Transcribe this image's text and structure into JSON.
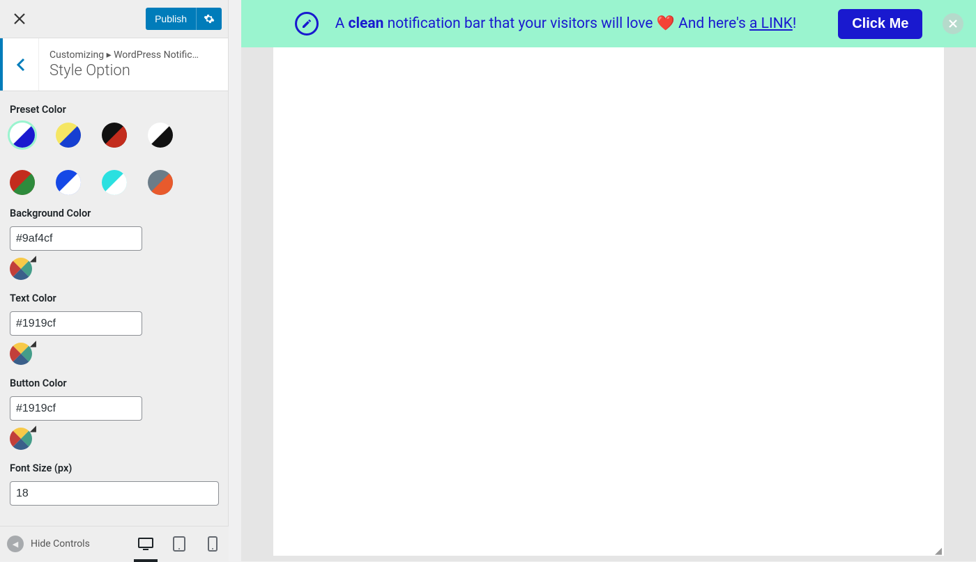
{
  "header": {
    "publish_label": "Publish"
  },
  "panel": {
    "breadcrumb": "Customizing ▸ WordPress Notific…",
    "title": "Style Option"
  },
  "preset_color": {
    "label": "Preset Color",
    "swatches": [
      {
        "a": "#ffffff",
        "b": "#1919cf",
        "selected": true
      },
      {
        "a": "#f5e663",
        "b": "#163fd1",
        "selected": false
      },
      {
        "a": "#111111",
        "b": "#c32c1d",
        "selected": false
      },
      {
        "a": "#ffffff",
        "b": "#111111",
        "selected": false
      },
      {
        "a": "#c32c1d",
        "b": "#2e8b3c",
        "selected": false
      },
      {
        "a": "#1548e6",
        "b": "#ffffff",
        "selected": false
      },
      {
        "a": "#2be0e0",
        "b": "#ffffff",
        "selected": false
      },
      {
        "a": "#6b7c88",
        "b": "#e85a2c",
        "selected": false
      }
    ]
  },
  "background_color": {
    "label": "Background Color",
    "value": "#9af4cf"
  },
  "text_color": {
    "label": "Text Color",
    "value": "#1919cf"
  },
  "button_color": {
    "label": "Button Color",
    "value": "#1919cf"
  },
  "font_size": {
    "label": "Font Size (px)",
    "value": "18"
  },
  "footer": {
    "hide_controls": "Hide Controls"
  },
  "notif": {
    "bg": "#9af4cf",
    "text_pre": "A ",
    "text_clean": "clean",
    "text_mid": " notification bar that your visitors will love ",
    "heart": "❤️",
    "text_and": " And here's ",
    "link_text": "a LINK",
    "text_end": "!",
    "button_label": "Click Me"
  }
}
